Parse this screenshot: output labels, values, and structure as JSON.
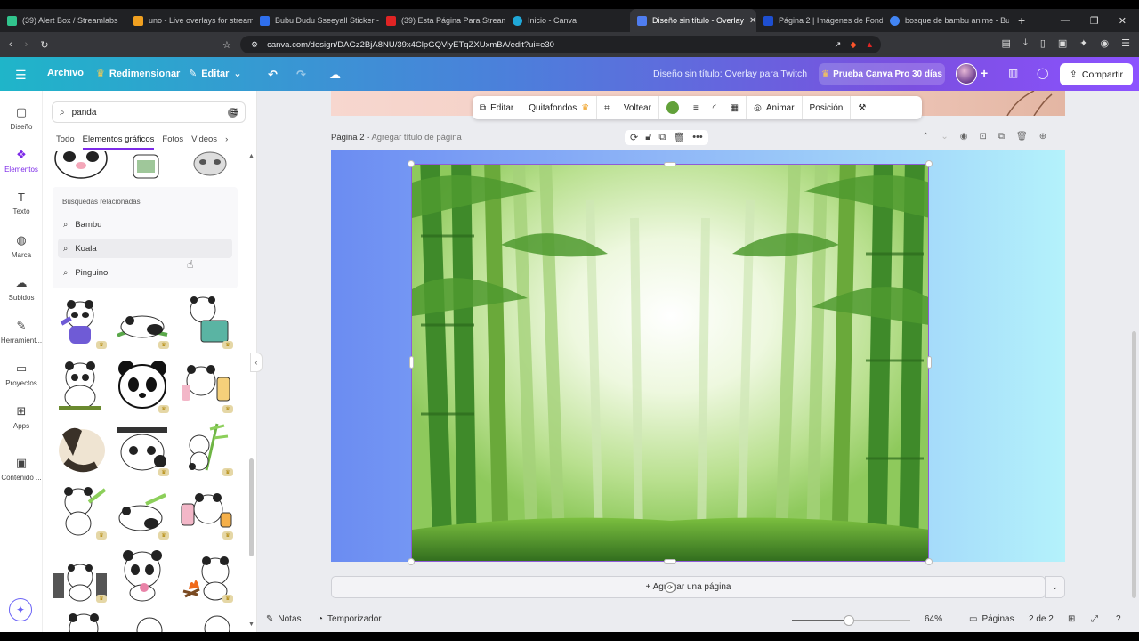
{
  "browser": {
    "tabs": [
      {
        "label": "(39) Alert Box / Streamlabs",
        "color": "#31c48d"
      },
      {
        "label": "uno - Live overlays for streamir",
        "color": "#f0a020"
      },
      {
        "label": "Bubu Dudu Sseeyall Sticker - B",
        "color": "#2f6fed"
      },
      {
        "label": "(39) Esta Página Para Streamer",
        "color": "#e02424"
      },
      {
        "label": "Inicio - Canva",
        "color": "#20a8d8"
      },
      {
        "label": "Diseño sin título - Overlay",
        "color": "#4f7df0"
      },
      {
        "label": "Página 2 | Imágenes de Fondo",
        "color": "#1e4fd1"
      },
      {
        "label": "bosque de bambu anime - Bus",
        "color": "#4285f4"
      }
    ],
    "active_tab_close": "✕",
    "url": "canva.com/design/DAGz2BjA8NU/39x4ClpGQVlyETqZXUxmBA/edit?ui=e30"
  },
  "header": {
    "archivo": "Archivo",
    "redimensionar": "Redimensionar",
    "editar": "Editar",
    "title": "Diseño sin título: Overlay para Twitch",
    "pro": "Prueba Canva Pro 30 días",
    "share": "Compartir"
  },
  "rail": [
    {
      "label": "Diseño",
      "icon": "▢"
    },
    {
      "label": "Elementos",
      "icon": "❖"
    },
    {
      "label": "Texto",
      "icon": "T"
    },
    {
      "label": "Marca",
      "icon": "◍"
    },
    {
      "label": "Subidos",
      "icon": "☁"
    },
    {
      "label": "Herramient...",
      "icon": "✎"
    },
    {
      "label": "Proyectos",
      "icon": "▭"
    },
    {
      "label": "Apps",
      "icon": "⊞"
    },
    {
      "label": "Contenido ...",
      "icon": "▣"
    }
  ],
  "panel": {
    "search_value": "panda",
    "tabs": [
      "Todo",
      "Elementos gráficos",
      "Fotos",
      "Videos"
    ],
    "related_title": "Búsquedas relacionadas",
    "related": [
      "Bambu",
      "Koala",
      "Pinguino"
    ]
  },
  "toolbar": {
    "editar": "Editar",
    "quitafondos": "Quitafondos",
    "voltear": "Voltear",
    "animar": "Animar",
    "posicion": "Posición",
    "swatch_color": "#62a13a"
  },
  "page": {
    "label": "Página 2 -",
    "hint": "Agregar título de página",
    "add_page": "+ Agregar una página"
  },
  "footer": {
    "notas": "Notas",
    "temporizador": "Temporizador",
    "zoom": "64%",
    "paginas": "Páginas",
    "count": "2 de 2"
  }
}
